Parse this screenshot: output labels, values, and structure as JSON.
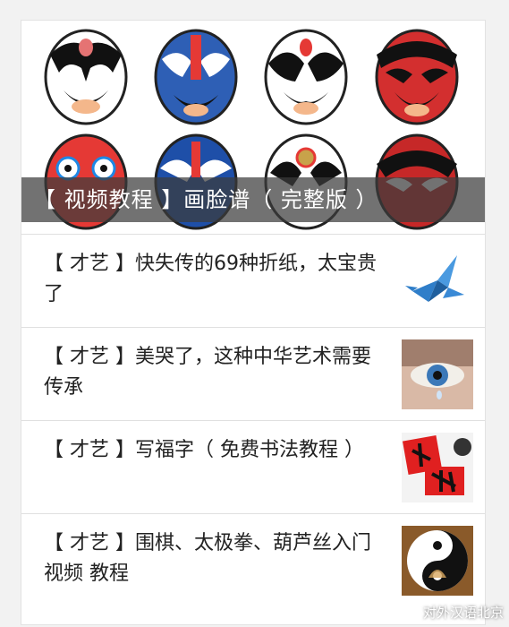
{
  "hero": {
    "caption": "【 视频教程 】画脸谱（ 完整版 ）",
    "masks": [
      "opera-mask-1",
      "opera-mask-2",
      "opera-mask-3",
      "opera-mask-4",
      "opera-mask-5",
      "opera-mask-6",
      "opera-mask-7",
      "opera-mask-8"
    ]
  },
  "articles": [
    {
      "title": "【 才艺 】快失传的69种折纸，太宝贵了",
      "thumb": "origami-bird-image"
    },
    {
      "title": "【 才艺 】美哭了，这种中华艺术需要传承",
      "thumb": "eye-art-image"
    },
    {
      "title": "【 才艺 】写福字（ 免费书法教程 ）",
      "thumb": "calligraphy-fu-image"
    },
    {
      "title": "【 才艺 】围棋、太极拳、葫芦丝入门视频 教程",
      "thumb": "taiji-meditation-image"
    }
  ],
  "watermark": {
    "text": "对外汉语北京"
  },
  "colors": {
    "caption_bg": "#3c3c3c",
    "border": "#e0e0e0",
    "text": "#222222"
  }
}
